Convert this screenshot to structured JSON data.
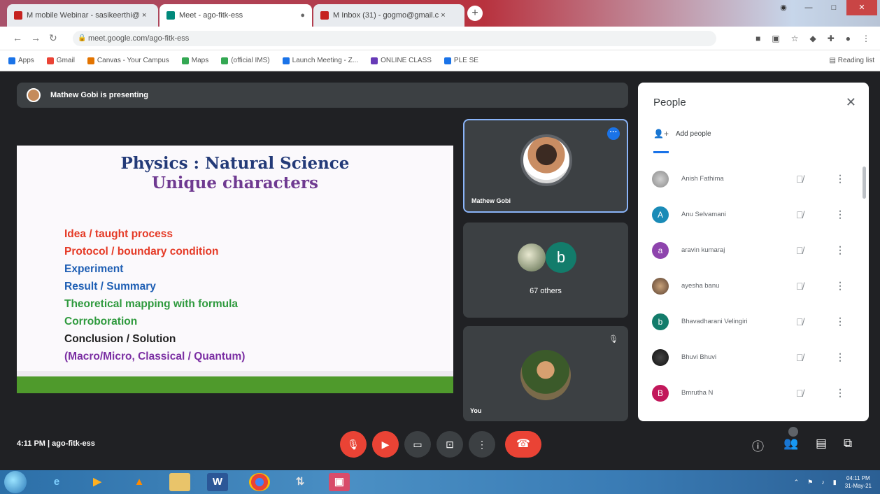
{
  "browser": {
    "tabs": [
      {
        "label": "M  mobile Webinar - sasikeerthi@ ×",
        "color": "#c5221f",
        "active": false
      },
      {
        "label": "Meet - ago-fitk-ess",
        "color": "#00897b",
        "active": true
      },
      {
        "label": "M  Inbox (31) - gogmo@gmail.c ×",
        "color": "#c5221f",
        "active": false
      }
    ],
    "url": "meet.google.com/ago-fitk-ess",
    "bookmarks": [
      {
        "label": "Apps",
        "color": "#1a73e8"
      },
      {
        "label": "Gmail",
        "color": "#ea4335"
      },
      {
        "label": "Canvas - Your Campus",
        "color": "#e37400"
      },
      {
        "label": "Maps",
        "color": "#34a853"
      },
      {
        "label": "(official IMS)",
        "color": "#34a853"
      },
      {
        "label": "Launch Meeting - Z...",
        "color": "#1a73e8"
      },
      {
        "label": "ONLINE CLASS",
        "color": "#673ab7"
      },
      {
        "label": "PLE SE",
        "color": "#1a73e8"
      }
    ],
    "reading_list": "Reading list"
  },
  "meet": {
    "presenting_text": "Mathew Gobi is presenting",
    "slide": {
      "title": "Physics : Natural Science",
      "subtitle": "Unique characters",
      "items": [
        {
          "text": "Idea / taught process",
          "color": "#e53a26"
        },
        {
          "text": "Protocol / boundary condition",
          "color": "#e53a26"
        },
        {
          "text": "Experiment",
          "color": "#1f5fb4"
        },
        {
          "text": "Result / Summary",
          "color": "#1f5fb4"
        },
        {
          "text": "Theoretical mapping with formula",
          "color": "#2f9a3e"
        },
        {
          "text": "Corroboration",
          "color": "#2f9a3e"
        },
        {
          "text": "Conclusion / Solution",
          "color": "#222222"
        },
        {
          "text": "(Macro/Micro, Classical / Quantum)",
          "color": "#7b2fa3"
        }
      ]
    },
    "tiles": {
      "presenter_name": "Mathew Gobi",
      "others_label": "67 others",
      "others_initial": "b",
      "you_label": "You"
    },
    "meeting_info": "4:11 PM  |  ago-fitk-ess"
  },
  "people": {
    "title": "People",
    "add_people": "Add people",
    "participants": [
      {
        "name": "Anish Fathima",
        "initial": "",
        "color": "#9aa0a6"
      },
      {
        "name": "Anu Selvamani",
        "initial": "A",
        "color": "#1a8bb7"
      },
      {
        "name": "aravin kumaraj",
        "initial": "a",
        "color": "#8e44ad"
      },
      {
        "name": "ayesha banu",
        "initial": "",
        "color": "#8b6b4a"
      },
      {
        "name": "Bhavadharani Velingiri",
        "initial": "b",
        "color": "#137c6b"
      },
      {
        "name": "Bhuvi Bhuvi",
        "initial": "",
        "color": "#222222"
      },
      {
        "name": "Bmrutha N",
        "initial": "B",
        "color": "#c2185b"
      }
    ]
  },
  "taskbar": {
    "time": "04:11 PM",
    "date": "31-May-21"
  }
}
